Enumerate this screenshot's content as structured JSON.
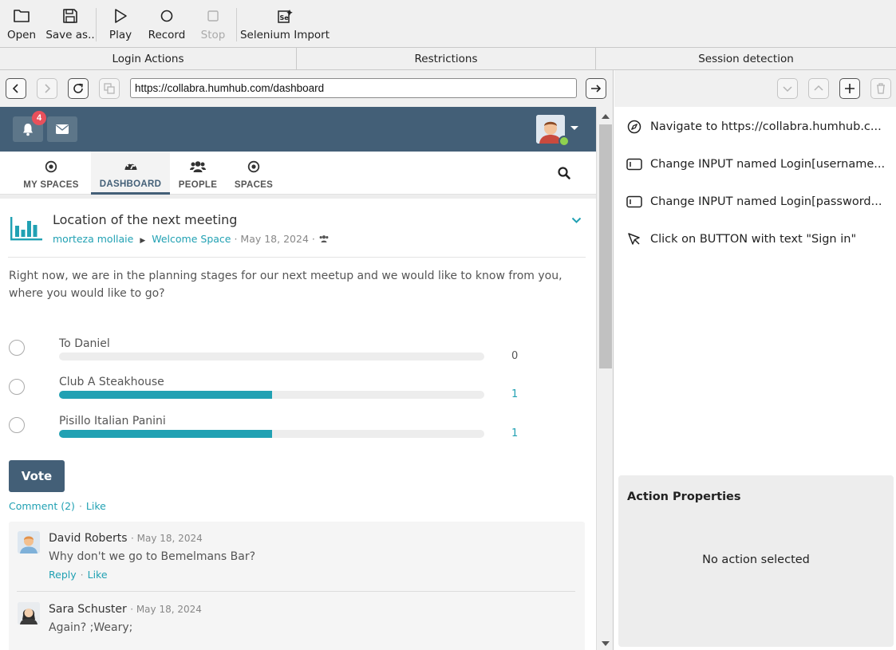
{
  "toolbar": {
    "open": "Open",
    "save_as": "Save as..",
    "play": "Play",
    "record": "Record",
    "stop": "Stop",
    "selenium_import": "Selenium Import"
  },
  "tabs": [
    "Login Actions",
    "Restrictions",
    "Session detection"
  ],
  "address_bar": {
    "url": "https://collabra.humhub.com/dashboard"
  },
  "humhub": {
    "notification_count": "4",
    "nav": {
      "my_spaces": "MY SPACES",
      "dashboard": "DASHBOARD",
      "people": "PEOPLE",
      "spaces": "SPACES"
    },
    "post": {
      "title": "Location of the next meeting",
      "author": "morteza mollaie",
      "space": "Welcome Space",
      "date": "· May 18, 2024 ·",
      "text": "Right now, we are in the planning stages for our next meetup and we would like to know from you, where you would like to go?",
      "options": [
        {
          "label": "To Daniel",
          "votes": "0",
          "fraction": 0.0
        },
        {
          "label": "Club A Steakhouse",
          "votes": "1",
          "fraction": 0.5
        },
        {
          "label": "Pisillo Italian Panini",
          "votes": "1",
          "fraction": 0.5
        }
      ],
      "vote_button": "Vote",
      "comment_link": "Comment (2)",
      "like_link": "Like"
    },
    "comments": [
      {
        "author": "David Roberts",
        "date": "· May 18, 2024",
        "text": "Why don't we go to Bemelmans Bar?",
        "reply": "Reply",
        "like": "Like"
      },
      {
        "author": "Sara Schuster",
        "date": "· May 18, 2024",
        "text": "Again? ;Weary;"
      }
    ]
  },
  "actions": [
    {
      "icon": "compass-icon",
      "text": "Navigate to https://collabra.humhub.c..."
    },
    {
      "icon": "input-field-icon",
      "text": "Change INPUT named Login[username..."
    },
    {
      "icon": "input-field-icon",
      "text": "Change INPUT named Login[password..."
    },
    {
      "icon": "cursor-click-icon",
      "text": "Click on BUTTON with text \"Sign in\""
    }
  ],
  "properties": {
    "title": "Action Properties",
    "empty_text": "No action selected"
  },
  "colors": {
    "humhub_header": "#435f77",
    "accent": "#21a1b3",
    "badge": "#e8505b",
    "online": "#8fd14f"
  }
}
